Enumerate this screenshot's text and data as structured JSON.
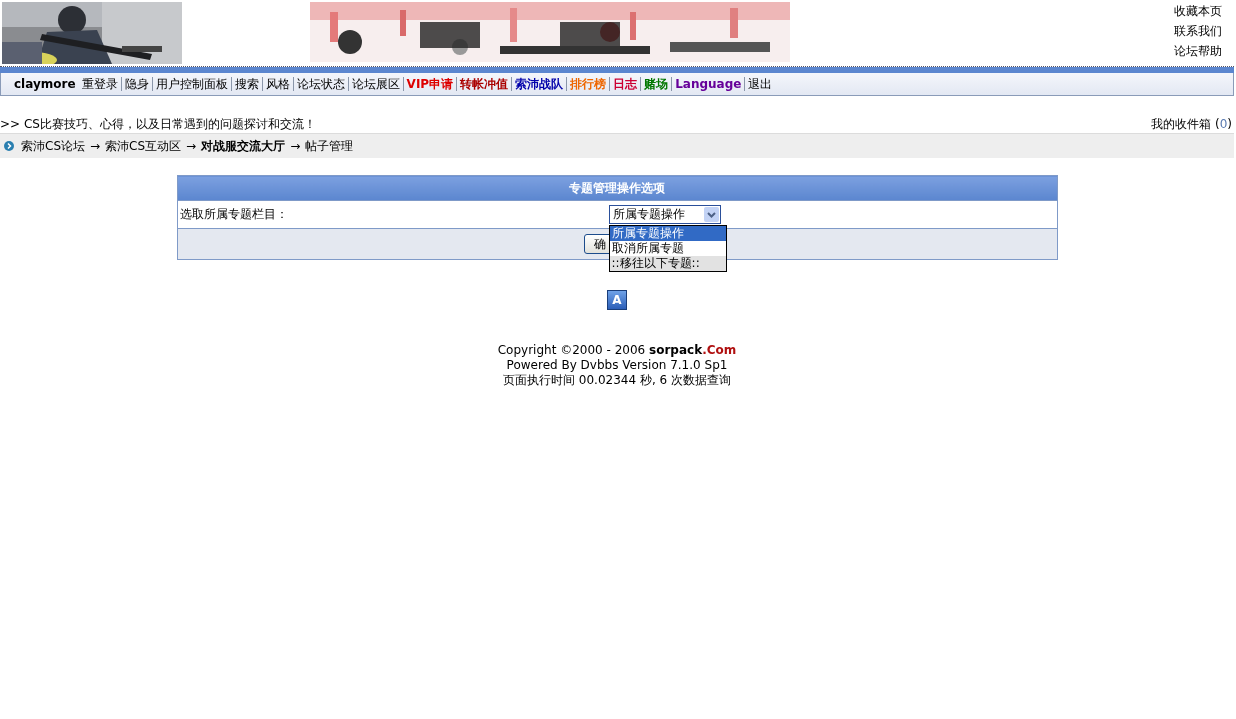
{
  "header": {
    "links": [
      "收藏本页",
      "联系我们",
      "论坛帮助"
    ]
  },
  "nav": [
    {
      "label": "claymore",
      "bold": true
    },
    {
      "label": "重登录",
      "bold": false
    },
    {
      "label": "隐身",
      "bold": false
    },
    {
      "label": "用户控制面板",
      "bold": false
    },
    {
      "label": "搜索",
      "bold": false
    },
    {
      "label": "风格",
      "bold": false
    },
    {
      "label": "论坛状态",
      "bold": false
    },
    {
      "label": "论坛展区",
      "bold": false
    },
    {
      "label": "VIP申请",
      "color": "#dd0000",
      "bold": true
    },
    {
      "label": "转帐冲值",
      "color": "#aa0000",
      "bold": true
    },
    {
      "label": "索沛战队",
      "color": "#0000aa",
      "bold": true
    },
    {
      "label": "排行榜",
      "color": "#ee6600",
      "bold": true
    },
    {
      "label": "日志",
      "color": "#cc0033",
      "bold": true
    },
    {
      "label": "赌场",
      "color": "#007700",
      "bold": true
    },
    {
      "label": "Language",
      "color": "#660099",
      "bold": true
    },
    {
      "label": "退出",
      "bold": false
    }
  ],
  "tagline": ">> CS比赛技巧、心得，以及日常遇到的问题探讨和交流！",
  "inbox": {
    "label": "我的收件箱 (",
    "count": "0",
    "close": ")"
  },
  "breadcrumb": [
    {
      "text": "索沛CS论坛",
      "bold": false
    },
    {
      "arrow": "→",
      "text": "索沛CS互动区",
      "bold": false
    },
    {
      "arrow": "→",
      "text": "对战服交流大厅",
      "bold": true
    },
    {
      "arrow": "→",
      "text": "帖子管理",
      "bold": false
    }
  ],
  "panel": {
    "title": "专题管理操作选项",
    "label": "选取所属专题栏目：",
    "select": {
      "value": "所属专题操作",
      "expanded": true,
      "options": [
        {
          "label": "所属专题操作",
          "selected": true,
          "kind": "option"
        },
        {
          "label": "取消所属专题",
          "selected": false,
          "kind": "option"
        },
        {
          "label": "::移往以下专题::",
          "selected": false,
          "kind": "group"
        }
      ]
    },
    "button": "确"
  },
  "icon_button": "A",
  "footer": {
    "copyright": "Copyright ©2000 - 2006 ",
    "brand": "sorpack",
    "brand_suffix": ".Com",
    "powered": "Powered By Dvbbs Version 7.1.0 Sp1",
    "timing": "页面执行时间 00.02344 秒, 6 次数据查询"
  }
}
